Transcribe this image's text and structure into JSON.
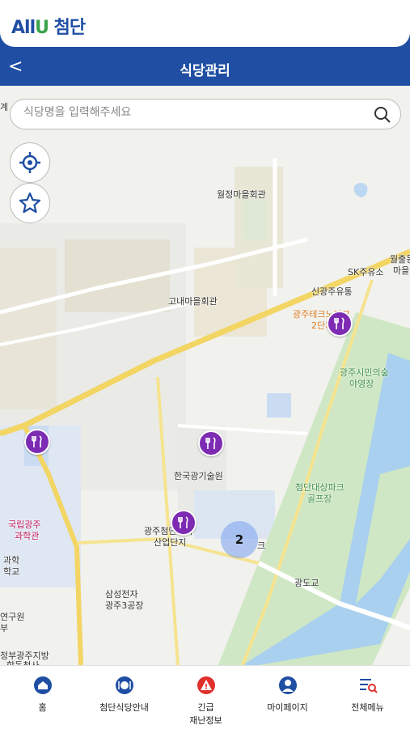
{
  "app": {
    "logo_prefix": "All",
    "logo_u": "U",
    "logo_suffix": " 첨단"
  },
  "header": {
    "title": "식당관리",
    "back": "<"
  },
  "search": {
    "placeholder": "식당명을 입력해주세요"
  },
  "map": {
    "labels": {
      "wolmang": "월정마을회관",
      "gonae": "고내마을회관",
      "sk": "SK주유소",
      "singwangju": "신광주유통",
      "techno": "광주테크노파크",
      "techno2": "2단지",
      "citizen": "광주시민의숲",
      "citizen2": "야영장",
      "wolchul": "월출동",
      "wolchul2": "마을",
      "photonics": "한국광기술원",
      "cheomdan_sanup": "광주첨단과학",
      "cheomdan_sanup2": "산업단지",
      "cheomdan_park": "첨단대상파크",
      "cheomdan_park2": "골프장",
      "samsung": "삼성전자",
      "samsung2": "광주3공장",
      "science": "국립광주",
      "science2": "과학관",
      "gwahak": "과학",
      "hakgyo": "학교",
      "yeonguwon": "연구원",
      "bu": "부",
      "jeongbu": "정부광주지방",
      "hapdong": "합동청사",
      "gwangdogyo": "광도교",
      "gye": "계",
      "techno_park": "크"
    },
    "cluster_count": "2"
  },
  "nav": {
    "home": "홈",
    "guide": "첨단식당안내",
    "emergency_1": "긴급",
    "emergency_2": "재난정보",
    "mypage": "마이페이지",
    "menu": "전체메뉴"
  },
  "colors": {
    "brand": "#1f4ea3",
    "pin": "#7d2bb3",
    "emergency": "#e0302c"
  }
}
